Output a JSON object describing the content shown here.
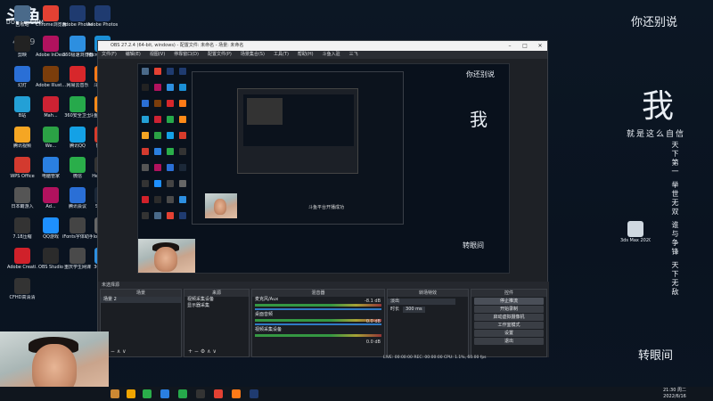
{
  "watermark": {
    "logo": "斗鱼",
    "sub": "DOUYU.COM",
    "room": "4859"
  },
  "desktop_icons": [
    {
      "label": "回收站",
      "color": "#4a6a8a"
    },
    {
      "label": "Chrome浏览器",
      "color": "#e34133"
    },
    {
      "label": "Adobe Photosh...",
      "color": "#1f3b70"
    },
    {
      "label": "Adobe Photosh...",
      "color": "#1f3b70"
    },
    {
      "label": "剪映",
      "color": "#222"
    },
    {
      "label": "Adobe InDesi...",
      "color": "#b1125e"
    },
    {
      "label": "360极速浏览器",
      "color": "#2d8fe0"
    },
    {
      "label": "Microsoft Edge",
      "color": "#1b8fd6"
    },
    {
      "label": "幻灯",
      "color": "#2a6fd6"
    },
    {
      "label": "Adobe Illust...",
      "color": "#7b3d0b"
    },
    {
      "label": "网易云音乐",
      "color": "#d7272b"
    },
    {
      "label": "斗鱼直播",
      "color": "#ff7a17"
    },
    {
      "label": "B站",
      "color": "#23a0d6"
    },
    {
      "label": "Mah...",
      "color": "#c23"
    },
    {
      "label": "360安全卫士",
      "color": "#26a94b"
    },
    {
      "label": "斗鱼直播伴侣",
      "color": "#ff8a18"
    },
    {
      "label": "腾讯视频",
      "color": "#f5a623"
    },
    {
      "label": "We...",
      "color": "#2ba245"
    },
    {
      "label": "腾讯QQ",
      "color": "#14a1e6"
    },
    {
      "label": "鲁大师",
      "color": "#d73b2b"
    },
    {
      "label": "WPS Office",
      "color": "#d33a2f"
    },
    {
      "label": "电脑管家",
      "color": "#2a7fe0"
    },
    {
      "label": "微信",
      "color": "#2aae4a"
    },
    {
      "label": "HelloFont",
      "color": "#333"
    },
    {
      "label": "日本霸游入",
      "color": "#555"
    },
    {
      "label": "Ad...",
      "color": "#b1125e"
    },
    {
      "label": "腾讯会议",
      "color": "#2a6fd6"
    },
    {
      "label": "Steam",
      "color": "#1b2838"
    },
    {
      "label": "7.18压缩",
      "color": "#333"
    },
    {
      "label": "QQ游戏",
      "color": "#1e90ff"
    },
    {
      "label": "iFonts字体助手",
      "color": "#444"
    },
    {
      "label": "logo样机",
      "color": "#666"
    },
    {
      "label": "Adobe Creati...",
      "color": "#d0212a"
    },
    {
      "label": "OBS Studio",
      "color": "#2b2b2b"
    },
    {
      "label": "重庆学生网课",
      "color": "#4a4a4a"
    },
    {
      "label": "360压缩",
      "color": "#2d8fe0"
    },
    {
      "label": "CFHD高清清",
      "color": "#333"
    }
  ],
  "poem": {
    "title": "你还别说",
    "line1": "我",
    "line2": "就是这么自信",
    "col1": "天下第一",
    "col2": "举世无双",
    "col3": "谁与争锋",
    "col4": "天下无敌",
    "footer": "转眼间"
  },
  "desktop_file": {
    "label": "3ds Max 2020 - S..."
  },
  "obs": {
    "title": "OBS 27.2.4 (64-bit, windows) - 配置文件: 未命名 - 场景: 未命名",
    "menu": [
      "文件(F)",
      "编辑(E)",
      "视图(V)",
      "停靠窗口(D)",
      "配置文件(P)",
      "场景集合(S)",
      "工具(T)",
      "帮助(H)",
      "斗鱼入驻",
      "三飞"
    ],
    "scene_bar_label": "未选择源",
    "docks": {
      "scenes": {
        "title": "场景",
        "items": [
          "场景 2"
        ]
      },
      "sources": {
        "title": "来源",
        "items": [
          "视频采集设备",
          "显示器采集"
        ]
      },
      "mixer": {
        "title": "混音器",
        "tracks": [
          {
            "name": "麦克风/Aux",
            "db": "-8.1 dB"
          },
          {
            "name": "桌面音频",
            "db": "0.0 dB"
          },
          {
            "name": "视频采集设备",
            "db": "0.0 dB"
          }
        ]
      },
      "transitions": {
        "title": "转场特效",
        "type": "淡出",
        "duration_label": "时长",
        "duration": "300 ms"
      },
      "controls": {
        "title": "控件",
        "buttons": [
          "停止推流",
          "开始录制",
          "启动虚拟摄像机",
          "工作室模式",
          "设置",
          "退出"
        ]
      }
    },
    "status": "LIVE: 00:00:00   REC: 00:00:00   CPU: 1.1%, 60.00 fps"
  },
  "taskbar": {
    "time": "21:30 周二",
    "date": "2022/6/16"
  },
  "colors": {
    "accent": "#2f79c5",
    "live": "#3bb54a"
  }
}
